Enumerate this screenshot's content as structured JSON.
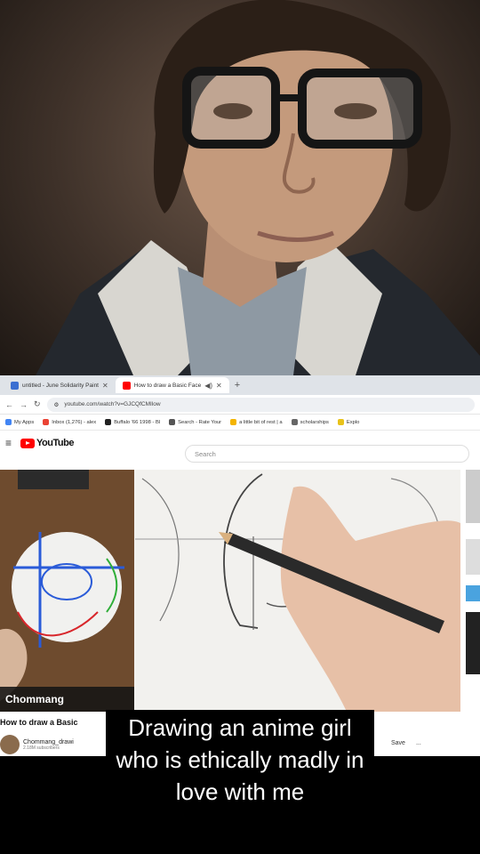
{
  "browser": {
    "tabs": [
      {
        "label": "untitled - June Solidarity Paint",
        "active": false,
        "color": "#3b6fd1"
      },
      {
        "label": "How to draw a Basic Face",
        "active": true,
        "color": "#ff0000"
      }
    ],
    "url": "youtube.com/watch?v=GJCQfCMIlow",
    "bookmarks": [
      {
        "label": "My Apps",
        "color": "#4285f4"
      },
      {
        "label": "Inbox (1,276) - alex",
        "color": "#ea4335"
      },
      {
        "label": "Buffalo '66 1998 - Bl",
        "color": "#222222"
      },
      {
        "label": "Search - Rate Your",
        "color": "#555555"
      },
      {
        "label": "a little bit of rest | a",
        "color": "#f4b400"
      },
      {
        "label": "scholarships",
        "color": "#666666"
      },
      {
        "label": "Explo",
        "color": "#e8c21a"
      }
    ]
  },
  "youtube": {
    "logo": "YouTube",
    "search_placeholder": "Search",
    "video_title": "How to draw a Basic",
    "channel_name": "Chommang_drawi",
    "channel_subs": "2.18M subscribers",
    "inset_label": "Chommang",
    "save_label": "Save",
    "more_label": "..."
  },
  "caption": {
    "line1": "Drawing an anime girl",
    "line2": "who is ethically madly in",
    "line3": "love with me"
  },
  "colors": {
    "youtube_red": "#ff0000",
    "caption_bg": "#000000",
    "caption_text": "#ffffff"
  }
}
